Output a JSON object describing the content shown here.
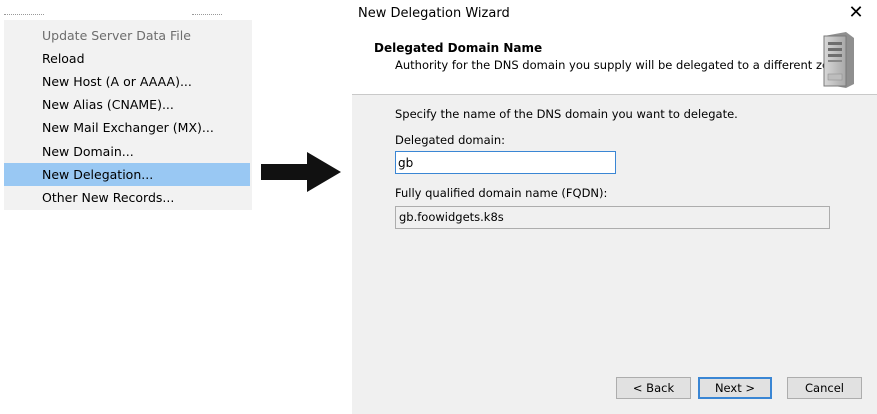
{
  "context_menu": {
    "items": [
      {
        "label": "Update Server Data File",
        "state": "disabled"
      },
      {
        "label": "Reload",
        "state": "normal"
      },
      {
        "label": "New Host (A or AAAA)...",
        "state": "normal"
      },
      {
        "label": "New Alias (CNAME)...",
        "state": "normal"
      },
      {
        "label": "New Mail Exchanger (MX)...",
        "state": "normal"
      },
      {
        "label": "New Domain...",
        "state": "normal"
      },
      {
        "label": "New Delegation...",
        "state": "selected"
      },
      {
        "label": "Other New Records...",
        "state": "normal"
      }
    ]
  },
  "wizard": {
    "window_title": "New Delegation Wizard",
    "close_glyph": "✕",
    "header_title": "Delegated Domain Name",
    "header_subtitle": "Authority for the DNS domain you supply will be delegated to a different zone.",
    "instruction": "Specify the name of the DNS domain you want to delegate.",
    "delegated_domain_label": "Delegated domain:",
    "delegated_domain_value": "gb",
    "fqdn_label": "Fully qualified domain name (FQDN):",
    "fqdn_value": "gb.foowidgets.k8s",
    "buttons": {
      "back": "< Back",
      "next": "Next >",
      "cancel": "Cancel"
    }
  },
  "colors": {
    "selection": "#99c8f3",
    "focus_border": "#3a86d4",
    "dialog_body": "#f0f0f0"
  }
}
